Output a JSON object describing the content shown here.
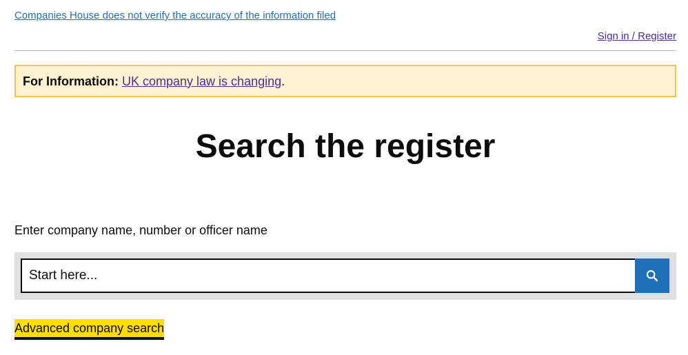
{
  "header": {
    "disclaimer_link": "Companies House does not verify the accuracy of the information filed",
    "signin_link": "Sign in / Register"
  },
  "info_banner": {
    "label": "For Information:",
    "link_text": "UK company law is changing",
    "suffix": "."
  },
  "main": {
    "title": "Search the register",
    "search_label": "Enter company name, number or officer name",
    "search_placeholder": "Start here...",
    "advanced_link": "Advanced company search"
  },
  "icons": {
    "search": "search-icon"
  },
  "colors": {
    "link_blue": "#1d70b8",
    "link_visited": "#4c2c92",
    "banner_background": "#fff2d3",
    "banner_border": "#f3c248",
    "search_panel": "#dee0e2",
    "focus_yellow": "#ffdd00",
    "text": "#0b0c0c"
  }
}
